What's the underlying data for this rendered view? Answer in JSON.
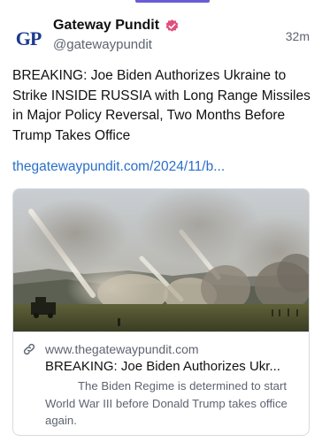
{
  "post": {
    "author": {
      "display_name": "Gateway Pundit",
      "handle": "@gatewaypundit",
      "avatar_text": "GP",
      "verified_color": "#e04f7c"
    },
    "timestamp": "32m",
    "text": "BREAKING: Joe Biden Authorizes Ukraine to Strike INSIDE RUSSIA with Long Range Missiles in Major Policy Reversal, Two Months Before Trump Takes Office",
    "link": "thegatewaypundit.com/2024/11/b...",
    "link_color": "#2a6fc9"
  },
  "card": {
    "domain": "www.thegatewaypundit.com",
    "title": "BREAKING: Joe Biden Authorizes Ukr...",
    "description": "The Biden Regime is determined to start World War III before Donald Trump takes office again.",
    "image_icon": "missile-launch-photo"
  }
}
